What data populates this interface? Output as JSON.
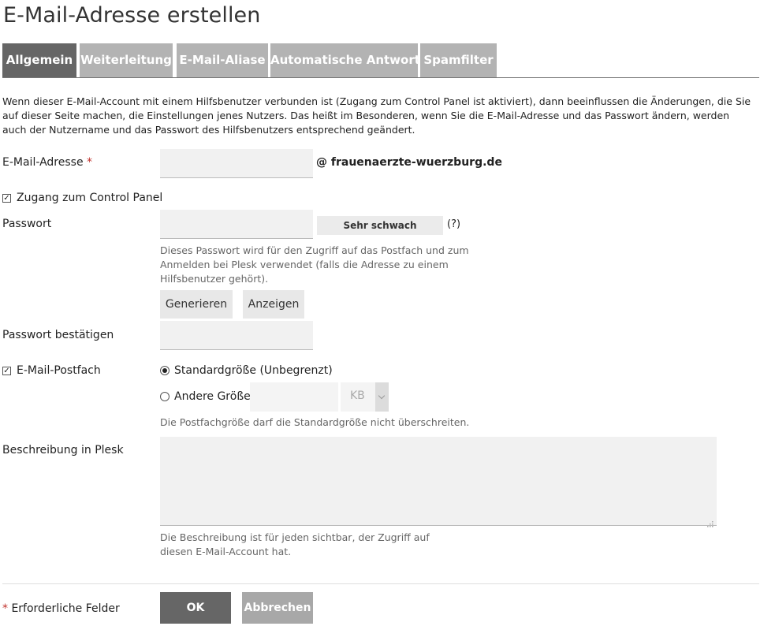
{
  "page": {
    "title": "E-Mail-Adresse erstellen"
  },
  "tabs": [
    {
      "label": "Allgemein",
      "active": true
    },
    {
      "label": "Weiterleitung",
      "active": false
    },
    {
      "label": "E-Mail-Aliase",
      "active": false
    },
    {
      "label": "Automatische Antwort",
      "active": false
    },
    {
      "label": "Spamfilter",
      "active": false
    }
  ],
  "intro": "Wenn dieser E-Mail-Account mit einem Hilfsbenutzer verbunden ist (Zugang zum Control Panel ist aktiviert), dann beeinflussen die Änderungen, die Sie auf dieser Seite machen, die Einstellungen jenes Nutzers. Das heißt im Besonderen, wenn Sie die E-Mail-Adresse und das Passwort ändern, werden auch der Nutzername und das Passwort des Hilfsbenutzers entsprechend geändert.",
  "email": {
    "label": "E-Mail-Adresse",
    "required_mark": "*",
    "value": "",
    "domain": "@ frauenaerzte-wuerzburg.de"
  },
  "control_panel": {
    "label": "Zugang zum Control Panel",
    "checked": true,
    "check_glyph": "✓"
  },
  "password": {
    "label": "Passwort",
    "value": "",
    "strength": "Sehr schwach",
    "help": "(?)",
    "hint": "Dieses Passwort wird für den Zugriff auf das Postfach und zum Anmelden bei Plesk verwendet (falls die Adresse zu einem Hilfsbenutzer gehört).",
    "generate_label": "Generieren",
    "show_label": "Anzeigen"
  },
  "password_confirm": {
    "label": "Passwort bestätigen",
    "value": ""
  },
  "mailbox": {
    "label": "E-Mail-Postfach",
    "checked": true,
    "check_glyph": "✓",
    "default_size_label": "Standardgröße (Unbegrenzt)",
    "other_size_label": "Andere Größe",
    "size_value": "",
    "unit": "KB",
    "hint": "Die Postfachgröße darf die Standardgröße nicht überschreiten."
  },
  "description": {
    "label": "Beschreibung in Plesk",
    "value": "",
    "hint": "Die Beschreibung ist für jeden sichtbar, der Zugriff auf diesen E-Mail-Account hat."
  },
  "footer": {
    "required_mark": "*",
    "required_text": "Erforderliche Felder",
    "ok_label": "OK",
    "cancel_label": "Abbrechen"
  }
}
